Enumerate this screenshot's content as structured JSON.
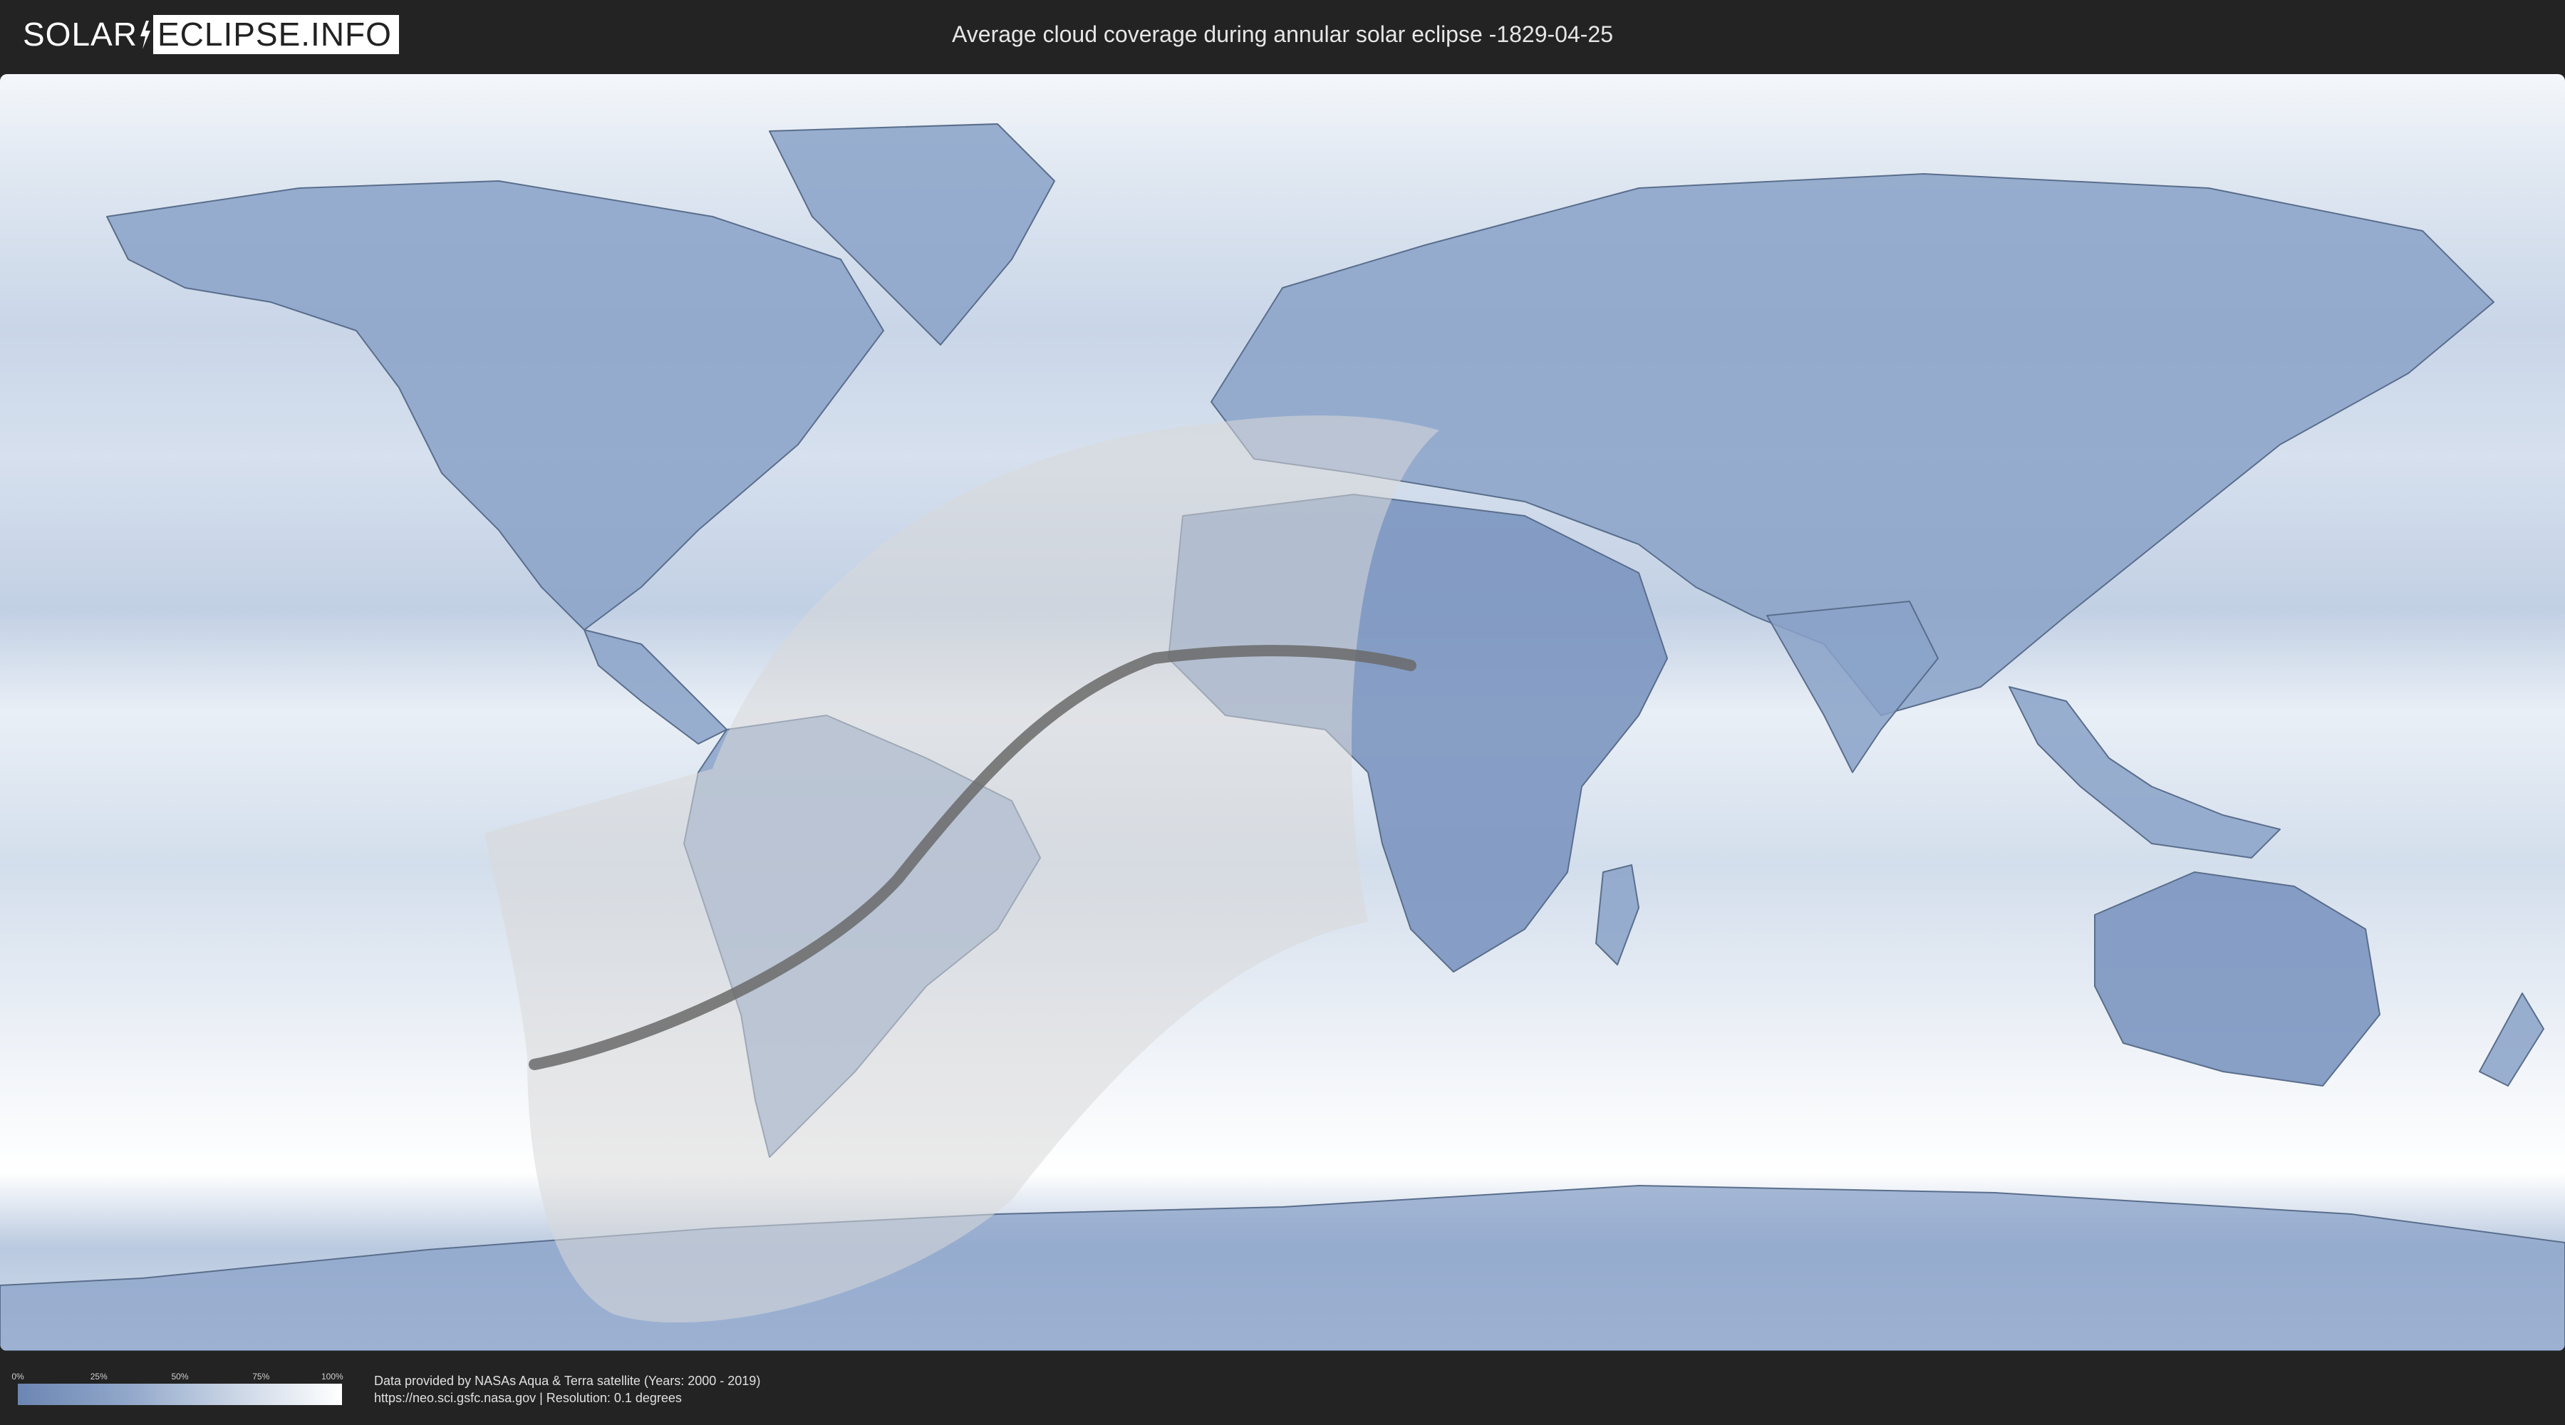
{
  "header": {
    "logo_left": "SOLAR",
    "logo_right": "ECLIPSE.INFO",
    "title": "Average cloud coverage during annular solar eclipse -1829-04-25"
  },
  "map": {
    "ocean_cloud_color": "#e4ecf5",
    "land_clear_color": "#8aa2c8",
    "dry_region_color": "#7c96c0",
    "boundary_color": "#5a6e8c",
    "eclipse_zone_color": "#d8d8d8",
    "central_line_color": "#6a6a6a"
  },
  "legend": {
    "ticks": [
      "0%",
      "25%",
      "50%",
      "75%",
      "100%"
    ],
    "gradient_colors": [
      "#6b86b3",
      "#93a9cb",
      "#c7d3e4",
      "#ffffff"
    ]
  },
  "credits": {
    "line1": "Data provided by NASAs Aqua & Terra satellite (Years: 2000 - 2019)",
    "line2": "https://neo.sci.gsfc.nasa.gov | Resolution: 0.1 degrees"
  }
}
